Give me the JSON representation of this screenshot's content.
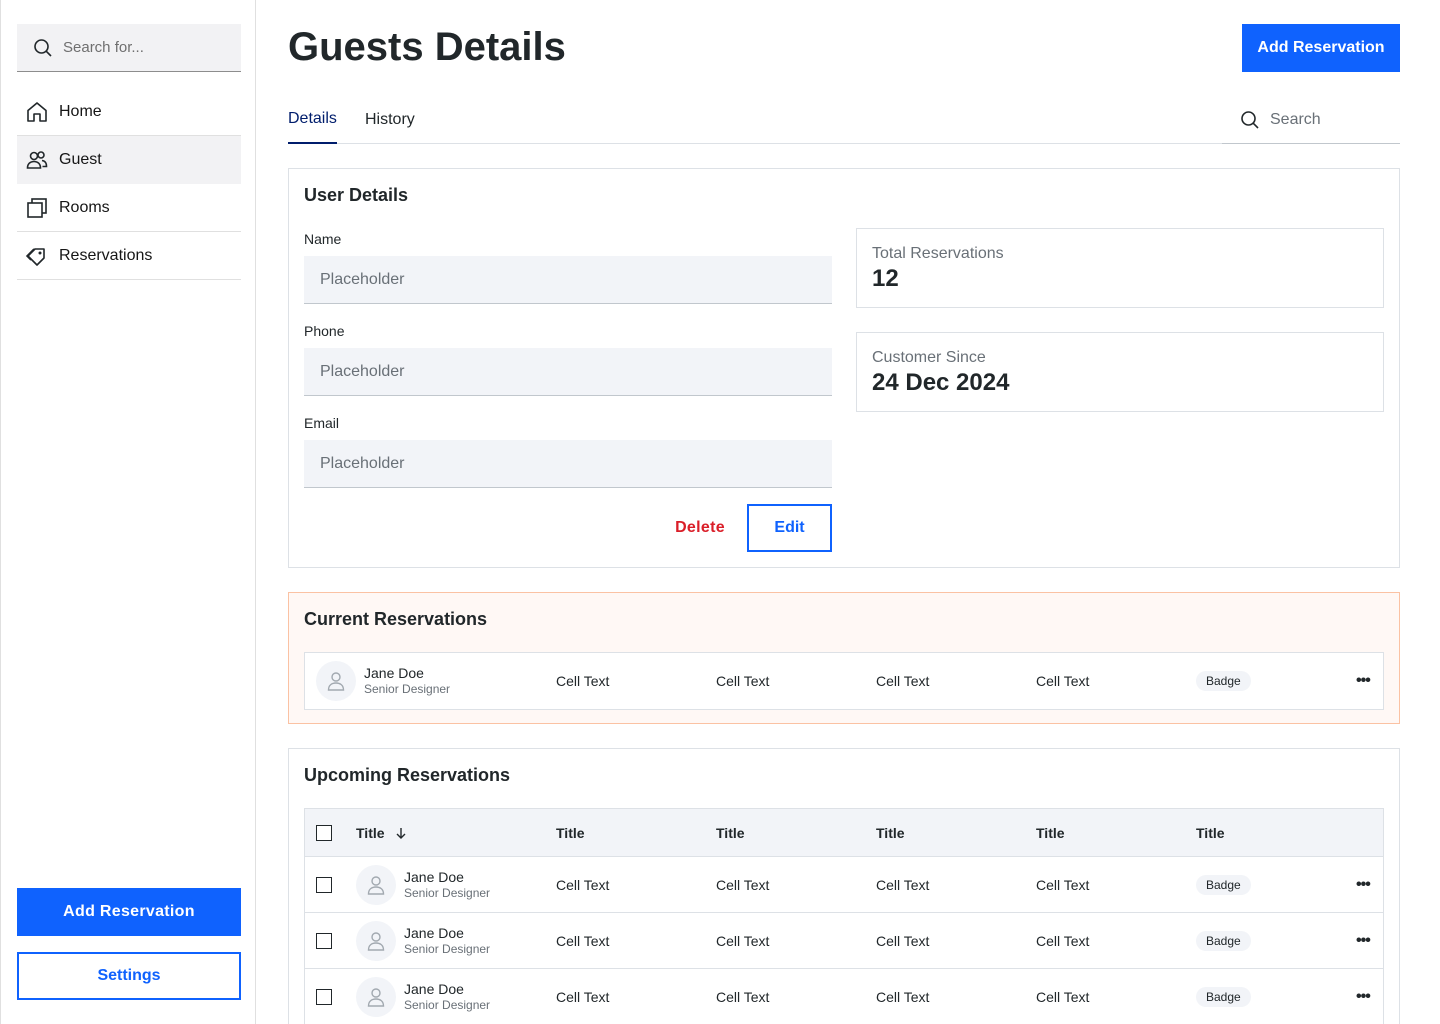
{
  "sidebar": {
    "search_placeholder": "Search for...",
    "items": [
      {
        "label": "Home",
        "icon": "home-icon"
      },
      {
        "label": "Guest",
        "icon": "users-icon",
        "active": true
      },
      {
        "label": "Rooms",
        "icon": "rooms-icon"
      },
      {
        "label": "Reservations",
        "icon": "tag-icon"
      }
    ],
    "primary_button": "Add Reservation",
    "secondary_button": "Settings"
  },
  "header": {
    "title": "Guests Details",
    "button": "Add Reservation"
  },
  "tabs": {
    "items": [
      "Details",
      "History"
    ],
    "active": "Details",
    "search_placeholder": "Search"
  },
  "user_details": {
    "title": "User Details",
    "fields": [
      {
        "label": "Name",
        "placeholder": "Placeholder"
      },
      {
        "label": "Phone",
        "placeholder": "Placeholder"
      },
      {
        "label": "Email",
        "placeholder": "Placeholder"
      }
    ],
    "delete_label": "Delete",
    "edit_label": "Edit",
    "stats": [
      {
        "label": "Total Reservations",
        "value": "12"
      },
      {
        "label": "Customer Since",
        "value": "24 Dec 2024"
      }
    ]
  },
  "current": {
    "title": "Current Reservations",
    "rows": [
      {
        "name": "Jane Doe",
        "role": "Senior Designer",
        "cells": [
          "Cell Text",
          "Cell Text",
          "Cell Text",
          "Cell Text"
        ],
        "badge": "Badge"
      }
    ]
  },
  "upcoming": {
    "title": "Upcoming Reservations",
    "headers": [
      "Title",
      "Title",
      "Title",
      "Title",
      "Title",
      "Title"
    ],
    "rows": [
      {
        "name": "Jane Doe",
        "role": "Senior Designer",
        "cells": [
          "Cell Text",
          "Cell Text",
          "Cell Text",
          "Cell Text"
        ],
        "badge": "Badge"
      },
      {
        "name": "Jane Doe",
        "role": "Senior Designer",
        "cells": [
          "Cell Text",
          "Cell Text",
          "Cell Text",
          "Cell Text"
        ],
        "badge": "Badge"
      },
      {
        "name": "Jane Doe",
        "role": "Senior Designer",
        "cells": [
          "Cell Text",
          "Cell Text",
          "Cell Text",
          "Cell Text"
        ],
        "badge": "Badge"
      }
    ]
  },
  "colors": {
    "accent": "#0f62fe",
    "danger": "#da1e28",
    "current_border": "#fbc2a3"
  }
}
